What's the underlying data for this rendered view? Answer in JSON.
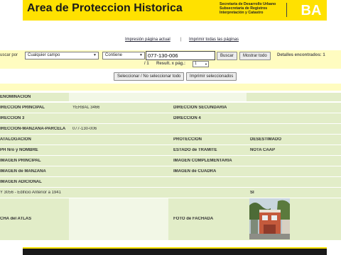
{
  "header": {
    "title": "Area de Proteccion Historica",
    "sub_lines": [
      "Secretaría de Desarrollo Urbano",
      "Subsecretaría de Registros",
      "Interpretación y Catastro"
    ],
    "logo_text": "BA",
    "brand_color": "#ffe100"
  },
  "links": {
    "print_page": "Impresión página actual",
    "separator": "|",
    "print_all": "Imprimir todas las páginas"
  },
  "search": {
    "by_label": "uscar por",
    "field_value": "Cualquier campo",
    "operator_value": "Contiene",
    "query_value": "077-130-006",
    "search_button": "Buscar",
    "show_all_button": "Mostrar todo",
    "found_label": "Detalles encontrados: 1",
    "pager_prev": "/ 1",
    "results_per_page_label": "Result. x pág.:",
    "results_per_page_value": "1",
    "select_toggle_button": "Seleccionar / No seleccionar todo",
    "print_selected_button": "Imprimir seleccionados"
  },
  "record": {
    "denominacion_label": "ENOMINACION",
    "direccion_principal_label": "IRECCION PRINCIPAL",
    "direccion_principal_value": "YERBAL 3466",
    "direccion_secundaria_label": "DIRECCION SECUNDARIA",
    "direccion3_label": "IRECCION 3",
    "direccion4_label": "DIRECCION 4",
    "smp_label": "IRECCION-MANZANA-PARCELA",
    "smp_value": "077-130-006",
    "catalogacion_label": "ATALOGACION",
    "proteccion_label": "PROTECCION",
    "proteccion_value": "DESESTIMADO",
    "ph_label": "PH Nro y NOMBRE",
    "estado_label": "ESTADO de TRAMITE",
    "estado_value": "NOTA CAAP",
    "img_principal_label": "IMAGEN PRINCIPAL",
    "img_complementaria_label": "IMAGEN COMPLEMENTARIA",
    "img_manzana_label": "IMAGEN de MANZANA",
    "img_cuadra_label": "IMAGEN de CUADRA",
    "img_adicional_label": "IMAGEN ADICIONAL",
    "ley_label": "Y 3056 - Edificio Anterior a 1941",
    "ley_value": "SI",
    "atlas_label": "CHA del ATLAS",
    "foto_fachada_label": "FOTO de FACHADA"
  }
}
